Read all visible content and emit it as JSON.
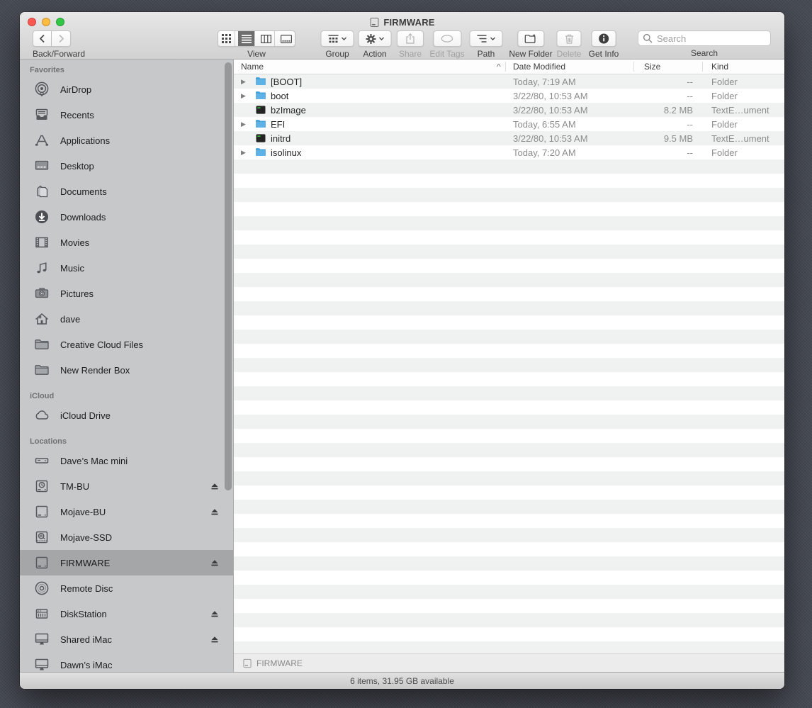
{
  "window": {
    "title": "FIRMWARE"
  },
  "toolbar": {
    "back_forward": {
      "label": "Back/Forward"
    },
    "view": {
      "label": "View",
      "selected": "list"
    },
    "group": {
      "label": "Group"
    },
    "action": {
      "label": "Action"
    },
    "share": {
      "label": "Share",
      "disabled": true
    },
    "edit_tags": {
      "label": "Edit Tags",
      "disabled": true
    },
    "path": {
      "label": "Path"
    },
    "new_folder": {
      "label": "New Folder"
    },
    "delete": {
      "label": "Delete",
      "disabled": true
    },
    "get_info": {
      "label": "Get Info"
    },
    "search": {
      "label": "Search",
      "placeholder": "Search"
    }
  },
  "sidebar": {
    "sections": [
      {
        "title": "Favorites",
        "items": [
          {
            "label": "AirDrop",
            "icon": "airdrop"
          },
          {
            "label": "Recents",
            "icon": "recents"
          },
          {
            "label": "Applications",
            "icon": "applications"
          },
          {
            "label": "Desktop",
            "icon": "desktop"
          },
          {
            "label": "Documents",
            "icon": "documents"
          },
          {
            "label": "Downloads",
            "icon": "downloads"
          },
          {
            "label": "Movies",
            "icon": "movies"
          },
          {
            "label": "Music",
            "icon": "music"
          },
          {
            "label": "Pictures",
            "icon": "pictures"
          },
          {
            "label": "dave",
            "icon": "home"
          },
          {
            "label": "Creative Cloud Files",
            "icon": "folder"
          },
          {
            "label": "New Render Box",
            "icon": "folder"
          }
        ]
      },
      {
        "title": "iCloud",
        "items": [
          {
            "label": "iCloud Drive",
            "icon": "cloud"
          }
        ]
      },
      {
        "title": "Locations",
        "items": [
          {
            "label": "Dave’s Mac mini",
            "icon": "macmini"
          },
          {
            "label": "TM-BU",
            "icon": "timemachine",
            "eject": true
          },
          {
            "label": "Mojave-BU",
            "icon": "extdrive",
            "eject": true
          },
          {
            "label": "Mojave-SSD",
            "icon": "ssd"
          },
          {
            "label": "FIRMWARE",
            "icon": "extdrive",
            "eject": true,
            "selected": true
          },
          {
            "label": "Remote Disc",
            "icon": "disc"
          },
          {
            "label": "DiskStation",
            "icon": "nas",
            "eject": true
          },
          {
            "label": "Shared iMac",
            "icon": "imac",
            "eject": true
          },
          {
            "label": "Dawn’s iMac",
            "icon": "imac"
          }
        ]
      }
    ]
  },
  "list": {
    "columns": {
      "name": "Name",
      "date": "Date Modified",
      "size": "Size",
      "kind": "Kind"
    },
    "sort_caret": "^",
    "rows": [
      {
        "name": "[BOOT]",
        "type": "folder",
        "expandable": true,
        "date": "Today, 7:19 AM",
        "size": "--",
        "kind": "Folder"
      },
      {
        "name": "boot",
        "type": "folder",
        "expandable": true,
        "date": "3/22/80, 10:53 AM",
        "size": "--",
        "kind": "Folder"
      },
      {
        "name": "bzImage",
        "type": "executable",
        "expandable": false,
        "date": "3/22/80, 10:53 AM",
        "size": "8.2 MB",
        "kind": "TextE…ument"
      },
      {
        "name": "EFI",
        "type": "folder",
        "expandable": true,
        "date": "Today, 6:55 AM",
        "size": "--",
        "kind": "Folder"
      },
      {
        "name": "initrd",
        "type": "executable",
        "expandable": false,
        "date": "3/22/80, 10:53 AM",
        "size": "9.5 MB",
        "kind": "TextE…ument"
      },
      {
        "name": "isolinux",
        "type": "folder",
        "expandable": true,
        "date": "Today, 7:20 AM",
        "size": "--",
        "kind": "Folder"
      }
    ]
  },
  "pathbar": {
    "volume": "FIRMWARE"
  },
  "statusbar": {
    "text": "6 items, 31.95 GB available"
  },
  "colors": {
    "folder_blue": "#5eb2e5",
    "sidebar_selection": "#a5a6a8",
    "traffic_red": "#fc5753",
    "traffic_yellow": "#fdbc40",
    "traffic_green": "#33c748",
    "desktop": "#474b54"
  }
}
